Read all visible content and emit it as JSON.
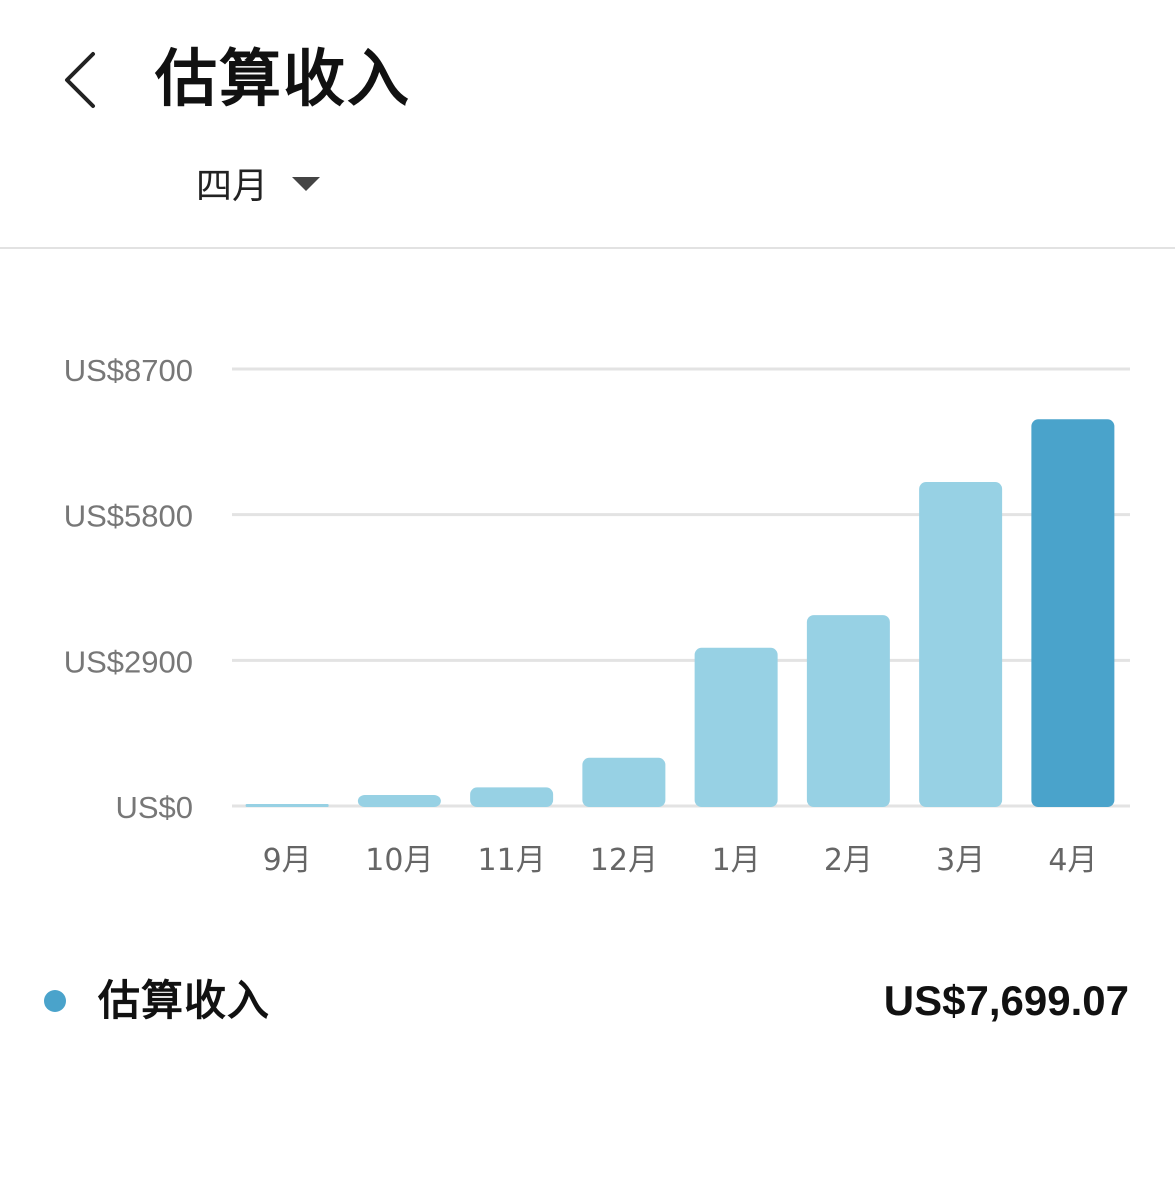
{
  "header": {
    "title": "估算收入",
    "back_icon": "chevron-left-icon",
    "month_selector": {
      "value": "四月",
      "icon": "caret-down-icon"
    }
  },
  "chart_data": {
    "type": "bar",
    "categories": [
      "9月",
      "10月",
      "11月",
      "12月",
      "1月",
      "2月",
      "3月",
      "4月"
    ],
    "values": [
      20,
      220,
      370,
      960,
      3150,
      3800,
      6450,
      7699.07
    ],
    "highlight_index": 7,
    "highlight_color": "#4aa3cb",
    "bar_color": "#97d1e4",
    "y_ticks": [
      0,
      2900,
      5800,
      8700
    ],
    "y_tick_labels": [
      "US$0",
      "US$2900",
      "US$5800",
      "US$8700"
    ],
    "ylim": [
      0,
      8700
    ],
    "grid": true,
    "legend_placement": "bottom-left"
  },
  "legend": {
    "label": "估算收入",
    "value": "US$7,699.07",
    "dot_color": "#4aa3cb"
  }
}
